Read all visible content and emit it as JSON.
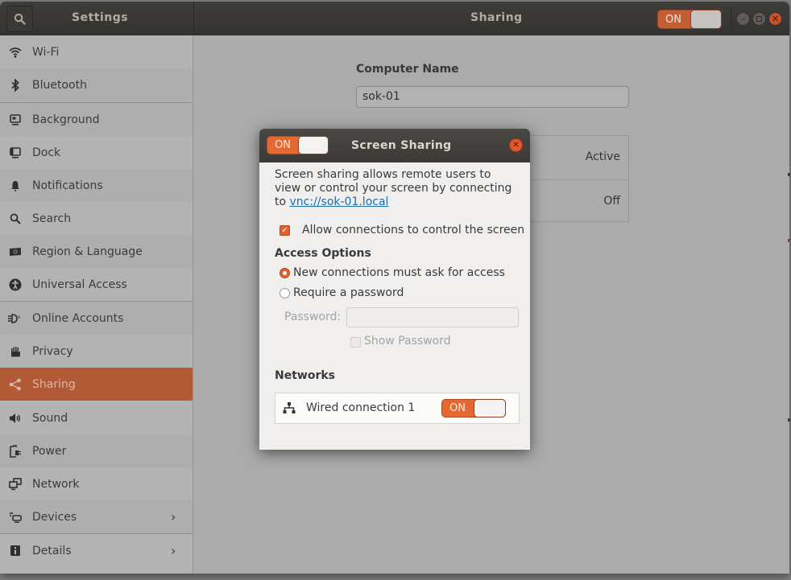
{
  "window": {
    "sidebar_title": "Settings",
    "panel_title": "Sharing",
    "master_toggle": {
      "label": "ON",
      "state": "on"
    },
    "controls": [
      "minimize",
      "maximize",
      "close"
    ]
  },
  "sidebar": {
    "items": [
      {
        "label": "Wi-Fi",
        "icon": "wifi-icon"
      },
      {
        "label": "Bluetooth",
        "icon": "bluetooth-icon"
      },
      {
        "label": "Background",
        "icon": "background-icon"
      },
      {
        "label": "Dock",
        "icon": "dock-icon"
      },
      {
        "label": "Notifications",
        "icon": "bell-icon"
      },
      {
        "label": "Search",
        "icon": "search-icon"
      },
      {
        "label": "Region & Language",
        "icon": "region-flag-icon"
      },
      {
        "label": "Universal Access",
        "icon": "accessibility-icon"
      },
      {
        "label": "Online Accounts",
        "icon": "online-accounts-icon"
      },
      {
        "label": "Privacy",
        "icon": "hand-icon"
      },
      {
        "label": "Sharing",
        "icon": "share-icon",
        "active": true
      },
      {
        "label": "Sound",
        "icon": "speaker-icon"
      },
      {
        "label": "Power",
        "icon": "power-plug-icon"
      },
      {
        "label": "Network",
        "icon": "network-icon"
      },
      {
        "label": "Devices",
        "icon": "devices-icon",
        "has_submenu": true
      },
      {
        "label": "Details",
        "icon": "info-icon",
        "has_submenu": true
      }
    ],
    "chevron": "›"
  },
  "main": {
    "computer_name_label": "Computer Name",
    "computer_name_value": "sok-01",
    "services": [
      {
        "status": "Active"
      },
      {
        "status": "Off"
      }
    ]
  },
  "dialog": {
    "title": "Screen Sharing",
    "toggle_label": "ON",
    "description_prefix": "Screen sharing allows remote users to view or control your screen by connecting to ",
    "vnc_link": "vnc://sok-01.local",
    "allow_control_label": "Allow connections to control the screen",
    "allow_control_checked": true,
    "access_options_heading": "Access Options",
    "access_options": [
      {
        "label": "New connections must ask for access",
        "selected": true
      },
      {
        "label": "Require a password",
        "selected": false
      }
    ],
    "password_label": "Password:",
    "password_value": "",
    "show_password_label": "Show Password",
    "networks_heading": "Networks",
    "networks": [
      {
        "label": "Wired connection 1",
        "toggle_label": "ON",
        "state": "on"
      }
    ]
  },
  "colors": {
    "accent": "#e4682f",
    "sidebar_active": "#b25a36",
    "titlebar": "#3c3b37",
    "link": "#1a6db3"
  }
}
